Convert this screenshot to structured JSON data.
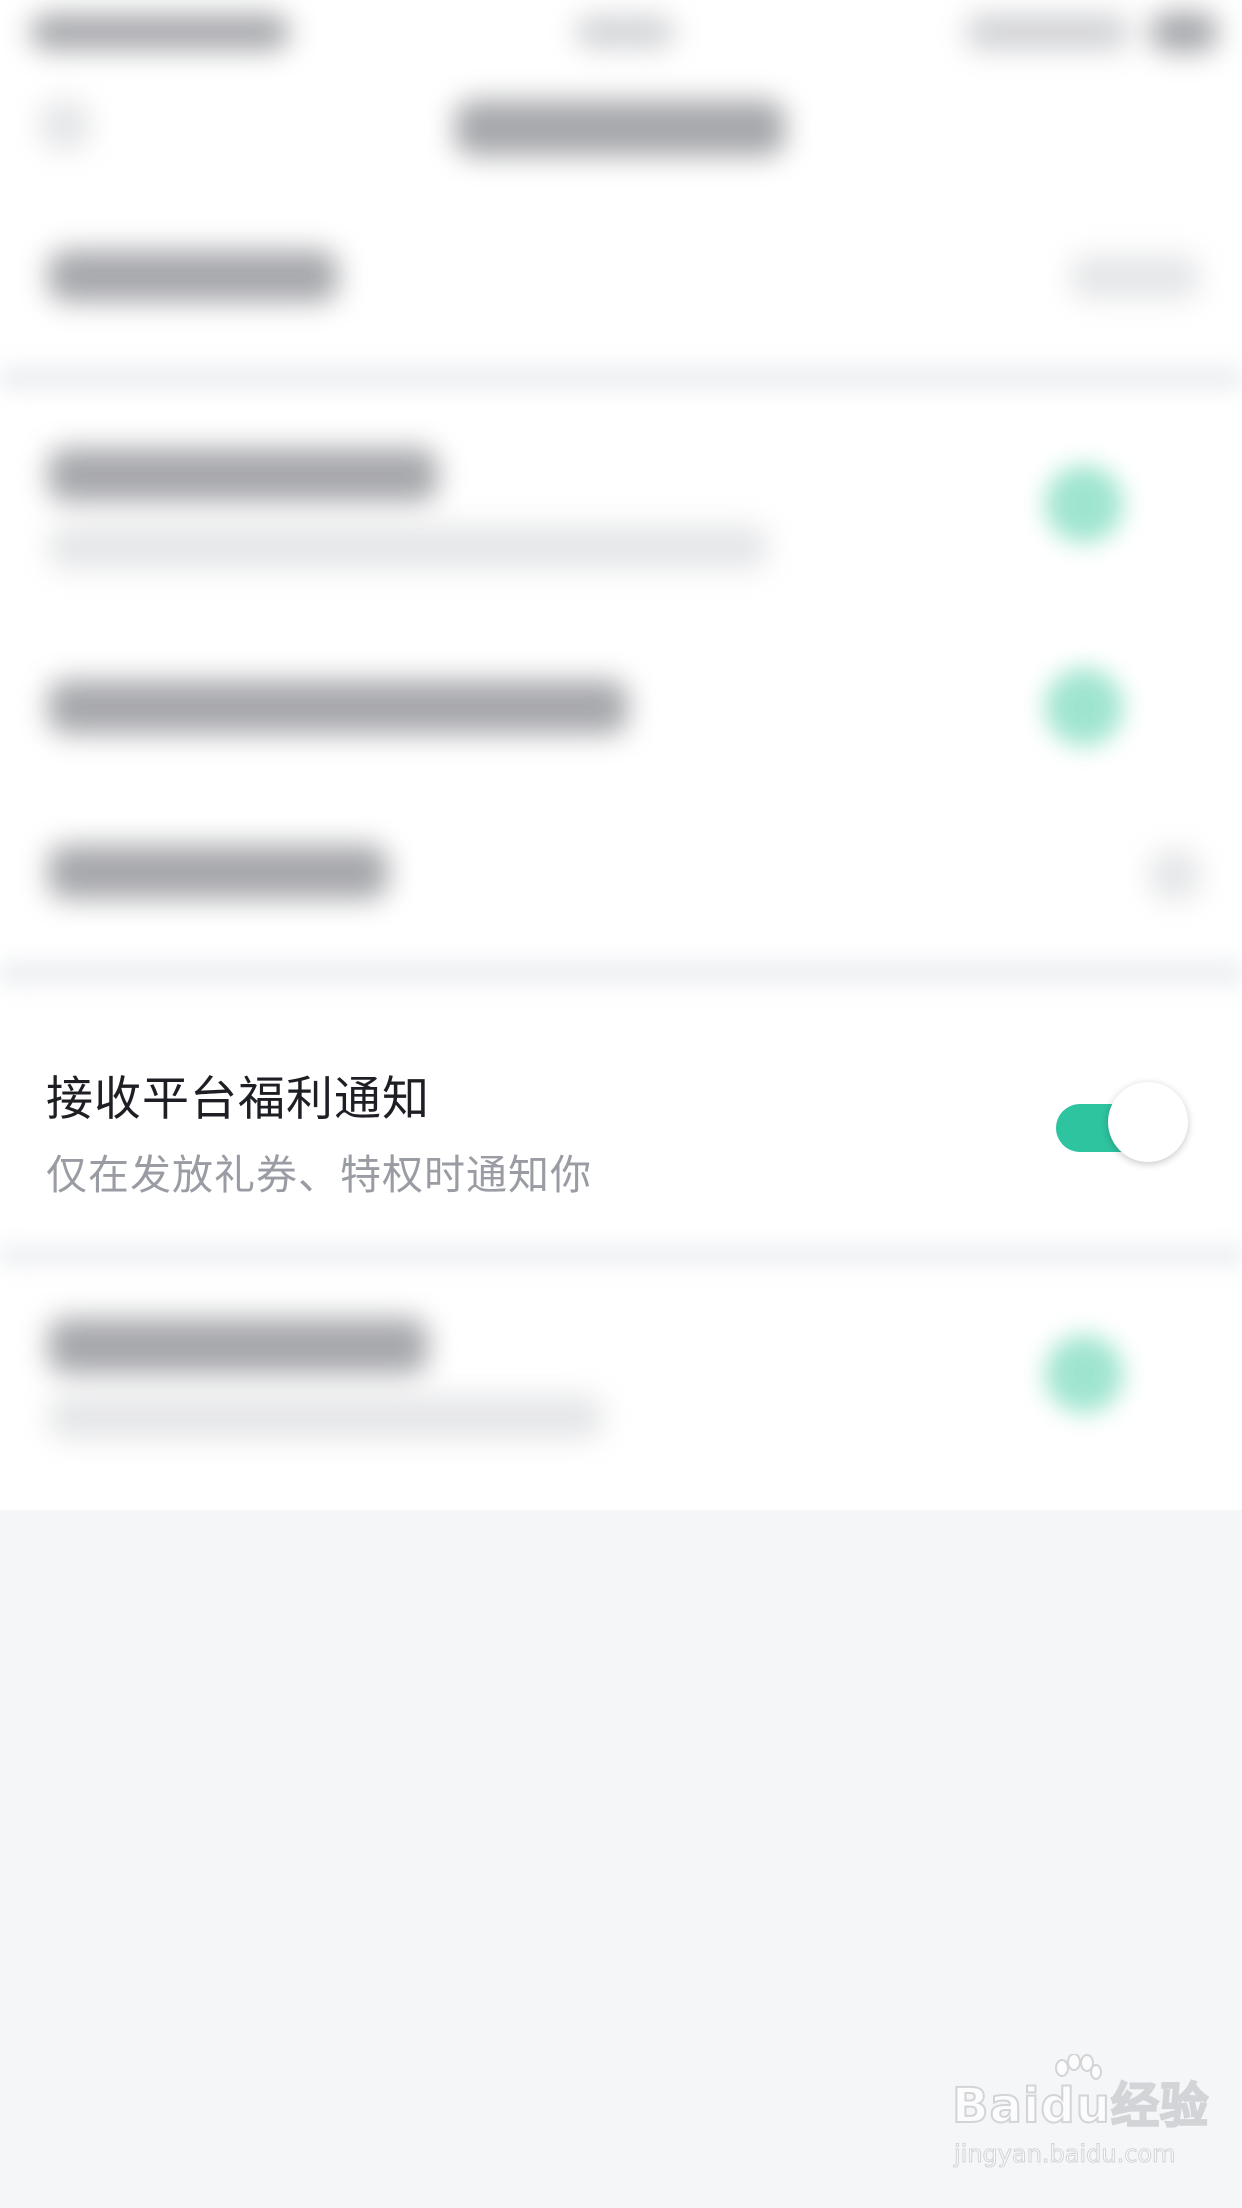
{
  "setting": {
    "title": "接收平台福利通知",
    "subtitle": "仅在发放礼券、特权时通知你",
    "enabled": true
  },
  "watermark": {
    "logo": "Baidu经验",
    "url": "jingyan.baidu.com"
  },
  "colors": {
    "accent": "#2ec4a0",
    "page_bg": "#f5f6f8",
    "title_text": "#1e1f24",
    "subtitle_text": "#9a9ca4"
  }
}
